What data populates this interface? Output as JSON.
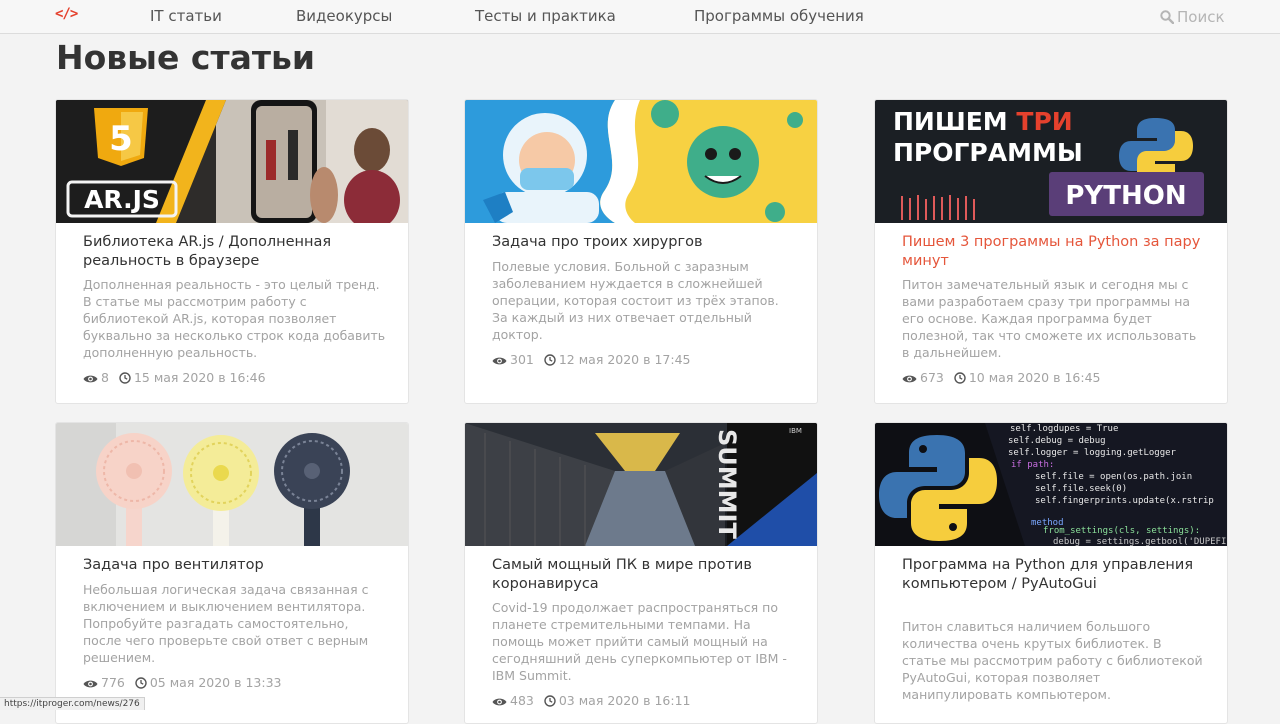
{
  "nav": {
    "logo": "</>",
    "items": [
      "IT статьи",
      "Видеокурсы",
      "Тесты и практика",
      "Программы обучения"
    ],
    "search_label": "Поиск"
  },
  "page_title": "Новые статьи",
  "cards": [
    {
      "title": "Библиотека AR.js / Дополненная реальность в браузере",
      "desc": "Дополненная реальность - это целый тренд. В статье мы рассмотрим работу с библиотекой AR.js, которая позволяет буквально за несколько строк кода добавить дополненную реальность.",
      "views": "8",
      "date": "15 мая 2020 в 16:46",
      "thumb_text": "AR.JS",
      "thumb_badge": "5"
    },
    {
      "title": "Задача про троих хирургов",
      "desc": "Полевые условия. Больной с заразным заболеванием нуждается в сложнейшей операции, которая состоит из трёх этапов. За каждый из них отвечает отдельный доктор.",
      "views": "301",
      "date": "12 мая 2020 в 17:45"
    },
    {
      "title": "Пишем 3 программы на Python за пару минут",
      "desc": "Питон замечательный язык и сегодня мы с вами разработаем сразу три программы на его основе. Каждая программа будет полезной, так что сможете их использовать в дальнейшем.",
      "views": "673",
      "date": "10 мая 2020 в 16:45",
      "thumb_line1a": "ПИШЕМ ",
      "thumb_line1b": "ТРИ",
      "thumb_line2": "ПРОГРАММЫ",
      "thumb_badge": "PYTHON"
    },
    {
      "title": "Задача про вентилятор",
      "desc": "Небольшая логическая задача связанная с включением и выключением вентилятора. Попробуйте разгадать самостоятельно, после чего проверьте свой ответ с верным решением.",
      "views": "776",
      "date": "05 мая 2020 в 13:33"
    },
    {
      "title": "Самый мощный ПК в мире против коронавируса",
      "desc": "Covid-19 продолжает распространяться по планете стремительными  темпами. На помощь может прийти самый мощный на сегодняшний день суперкомпьютер от IBM - IBM Summit.",
      "views": "483",
      "date": "03 мая 2020 в 16:11",
      "thumb_text": "SUMMIT",
      "thumb_brand": "IBM"
    },
    {
      "title": "Программа на Python для управления компьютером / PyAutoGui",
      "desc": "Питон славиться наличием большого количества очень крутых библиотек. В статье мы рассмотрим работу с библиотекой PyAutoGui, которая позволяет манипулировать компьютером.",
      "thumb_code": [
        "self.logdupes = True",
        "self.debug = debug",
        "self.logger = logging.getLogger",
        "if path:",
        "self.file = open(os.path.join",
        "self.file.seek(0)",
        "self.fingerprints.update(x.rstrip",
        "method",
        "from_settings(cls, settings):",
        "debug = settings.getbool('DUPEFILTER_DEBUG"
      ]
    }
  ],
  "status_url": "https://itproger.com/news/276"
}
